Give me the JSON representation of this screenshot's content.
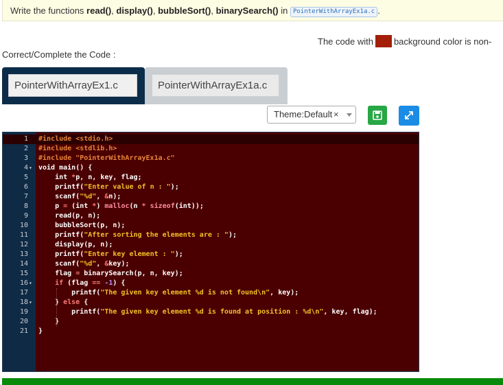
{
  "task": {
    "prefix": "Write the functions ",
    "fn1": "read()",
    "sep1": ", ",
    "fn2": "display()",
    "sep2": ", ",
    "fn3": "bubbleSort()",
    "sep3": ", ",
    "fn4": "binarySearch()",
    "in_text": " in ",
    "file_tag": "PointerWithArrayEx1a.c",
    "suffix": "."
  },
  "note": {
    "before": "The code with",
    "after": "background color is non-",
    "swatch_color": "#a41f08"
  },
  "subtitle": "Correct/Complete the Code :",
  "tabs": [
    {
      "label": "PointerWithArrayEx1.c",
      "active": true
    },
    {
      "label": "PointerWithArrayEx1a.c",
      "active": false
    }
  ],
  "toolbar": {
    "theme_label": "Theme:Default",
    "clear_glyph": "×",
    "save_icon": "floppy-disk-icon",
    "expand_icon": "expand-arrows-icon"
  },
  "editor": {
    "background": "#4a0000",
    "lines": [
      {
        "num": "1",
        "fold": ""
      },
      {
        "num": "2",
        "fold": ""
      },
      {
        "num": "3",
        "fold": ""
      },
      {
        "num": "4",
        "fold": "▾"
      },
      {
        "num": "5",
        "fold": ""
      },
      {
        "num": "6",
        "fold": ""
      },
      {
        "num": "7",
        "fold": ""
      },
      {
        "num": "8",
        "fold": ""
      },
      {
        "num": "9",
        "fold": ""
      },
      {
        "num": "10",
        "fold": ""
      },
      {
        "num": "11",
        "fold": ""
      },
      {
        "num": "12",
        "fold": ""
      },
      {
        "num": "13",
        "fold": ""
      },
      {
        "num": "14",
        "fold": ""
      },
      {
        "num": "15",
        "fold": ""
      },
      {
        "num": "16",
        "fold": "▾"
      },
      {
        "num": "17",
        "fold": ""
      },
      {
        "num": "18",
        "fold": "▾"
      },
      {
        "num": "19",
        "fold": ""
      },
      {
        "num": "20",
        "fold": ""
      },
      {
        "num": "21",
        "fold": ""
      }
    ],
    "code": [
      [
        [
          "#include ",
          "#e9843a"
        ],
        [
          "<stdio.h>",
          "#e9843a"
        ]
      ],
      [
        [
          "#include ",
          "#e9843a"
        ],
        [
          "<stdlib.h>",
          "#e9843a"
        ]
      ],
      [
        [
          "#include ",
          "#e9843a"
        ],
        [
          "\"PointerWithArrayEx1a.c\"",
          "#e9843a"
        ]
      ],
      [
        [
          "void ",
          "#ffffff"
        ],
        [
          "main() {",
          "#ffffff"
        ]
      ],
      [
        [
          "    int ",
          "#ffffff"
        ],
        [
          "*",
          "#ff7d7d"
        ],
        [
          "p, n, key, flag;",
          "#ffffff"
        ]
      ],
      [
        [
          "    printf(",
          "#ffffff"
        ],
        [
          "\"Enter value of n : \"",
          "#f5c028"
        ],
        [
          ");",
          "#ffffff"
        ]
      ],
      [
        [
          "    scanf(",
          "#ffffff"
        ],
        [
          "\"%d\"",
          "#f5c028"
        ],
        [
          ", ",
          "#ffffff"
        ],
        [
          "&",
          "#ff7d7d"
        ],
        [
          "n);",
          "#ffffff"
        ]
      ],
      [
        [
          "    p ",
          "#ffffff"
        ],
        [
          "= ",
          "#ff7d7d"
        ],
        [
          "(int ",
          "#ffffff"
        ],
        [
          "*",
          "#ff7d7d"
        ],
        [
          ") ",
          "#ffffff"
        ],
        [
          "malloc",
          "#ff8fa0"
        ],
        [
          "(n ",
          "#ffffff"
        ],
        [
          "* ",
          "#ff7d7d"
        ],
        [
          "sizeof",
          "#ff8fa0"
        ],
        [
          "(int));",
          "#ffffff"
        ]
      ],
      [
        [
          "    read(p, n);",
          "#ffffff"
        ]
      ],
      [
        [
          "    bubbleSort(p, n);",
          "#ffffff"
        ]
      ],
      [
        [
          "    printf(",
          "#ffffff"
        ],
        [
          "\"After sorting the elements are : \"",
          "#f5c028"
        ],
        [
          ");",
          "#ffffff"
        ]
      ],
      [
        [
          "    display(p, n);",
          "#ffffff"
        ]
      ],
      [
        [
          "    printf(",
          "#ffffff"
        ],
        [
          "\"Enter key element : \"",
          "#f5c028"
        ],
        [
          ");",
          "#ffffff"
        ]
      ],
      [
        [
          "    scanf(",
          "#ffffff"
        ],
        [
          "\"%d\"",
          "#f5c028"
        ],
        [
          ", ",
          "#ffffff"
        ],
        [
          "&",
          "#ff7d7d"
        ],
        [
          "key);",
          "#ffffff"
        ]
      ],
      [
        [
          "    flag ",
          "#ffffff"
        ],
        [
          "= ",
          "#ff7d7d"
        ],
        [
          "binarySearch(p, n, key);",
          "#ffffff"
        ]
      ],
      [
        [
          "    if ",
          "#ff7d7d"
        ],
        [
          "(flag ",
          "#ffffff"
        ],
        [
          "== ",
          "#ff7d7d"
        ],
        [
          "-1",
          "#b58cff"
        ],
        [
          ") {",
          "#ffffff"
        ]
      ],
      [
        [
          "        printf(",
          "#ffffff"
        ],
        [
          "\"The given key element %d is not found\\n\"",
          "#f5c028"
        ],
        [
          ", key);",
          "#ffffff"
        ]
      ],
      [
        [
          "    } ",
          "#ffffff"
        ],
        [
          "else ",
          "#ff7d7d"
        ],
        [
          "{",
          "#ffffff"
        ]
      ],
      [
        [
          "        printf(",
          "#ffffff"
        ],
        [
          "\"The given key element %d is found at position : %d\\n\"",
          "#f5c028"
        ],
        [
          ", key, flag);",
          "#ffffff"
        ]
      ],
      [
        [
          "    }",
          "#ffffff"
        ]
      ],
      [
        [
          "}",
          "#ffffff"
        ]
      ]
    ]
  }
}
